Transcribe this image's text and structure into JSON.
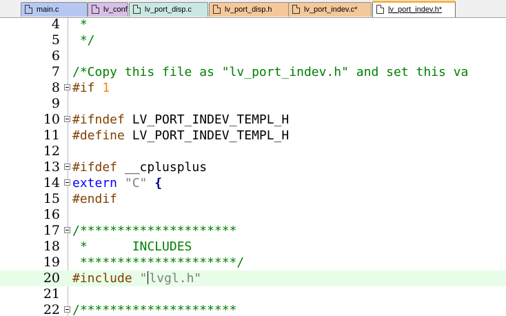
{
  "tabs": [
    {
      "label": "main.c",
      "bg": "#b6c7f2"
    },
    {
      "label": "lv_conf.h",
      "bg": "#d7bfe8"
    },
    {
      "label": "lv_port_disp.c",
      "bg": "#c9e8e4"
    },
    {
      "label": "lv_port_disp.h",
      "bg": "#f4c89a"
    },
    {
      "label": "lv_port_indev.c*",
      "bg": "#f4c89a"
    },
    {
      "label": "lv_port_indev.h*",
      "bg": "#ffffff",
      "active": true
    }
  ],
  "editor": {
    "current_line": "20",
    "lines": [
      {
        "num": "4",
        "code": " *",
        "type": "comment"
      },
      {
        "num": "5",
        "code": " */",
        "type": "comment"
      },
      {
        "num": "6",
        "code": "",
        "type": "plain"
      },
      {
        "num": "7",
        "code": "/*Copy this file as \"lv_port_indev.h\" and set this va",
        "type": "comment"
      },
      {
        "num": "8",
        "pre": "#if",
        "rest": " 1",
        "type": "if",
        "fold": true
      },
      {
        "num": "9",
        "code": "",
        "type": "plain"
      },
      {
        "num": "10",
        "pre": "#ifndef",
        "rest": " LV_PORT_INDEV_TEMPL_H",
        "type": "pre",
        "fold": true
      },
      {
        "num": "11",
        "pre": "#define",
        "rest": " LV_PORT_INDEV_TEMPL_H",
        "type": "pre"
      },
      {
        "num": "12",
        "code": "",
        "type": "plain"
      },
      {
        "num": "13",
        "pre": "#ifdef",
        "rest": " __cplusplus",
        "type": "pre",
        "fold": true
      },
      {
        "num": "14",
        "kw": "extern",
        "str": "\"C\"",
        "op": "{",
        "type": "extern",
        "fold": true
      },
      {
        "num": "15",
        "pre": "#endif",
        "rest": "",
        "type": "pre"
      },
      {
        "num": "16",
        "code": "",
        "type": "plain"
      },
      {
        "num": "17",
        "code": "/*********************",
        "type": "comment",
        "fold": true
      },
      {
        "num": "18",
        "code": " *      INCLUDES",
        "type": "comment"
      },
      {
        "num": "19",
        "code": " *********************/",
        "type": "comment"
      },
      {
        "num": "20",
        "pre": "#include",
        "str_a": "\"",
        "str_b": "lvgl.h\"",
        "type": "include"
      },
      {
        "num": "21",
        "code": "",
        "type": "plain"
      },
      {
        "num": "22",
        "code": "/*********************",
        "type": "comment",
        "fold": true
      }
    ]
  }
}
